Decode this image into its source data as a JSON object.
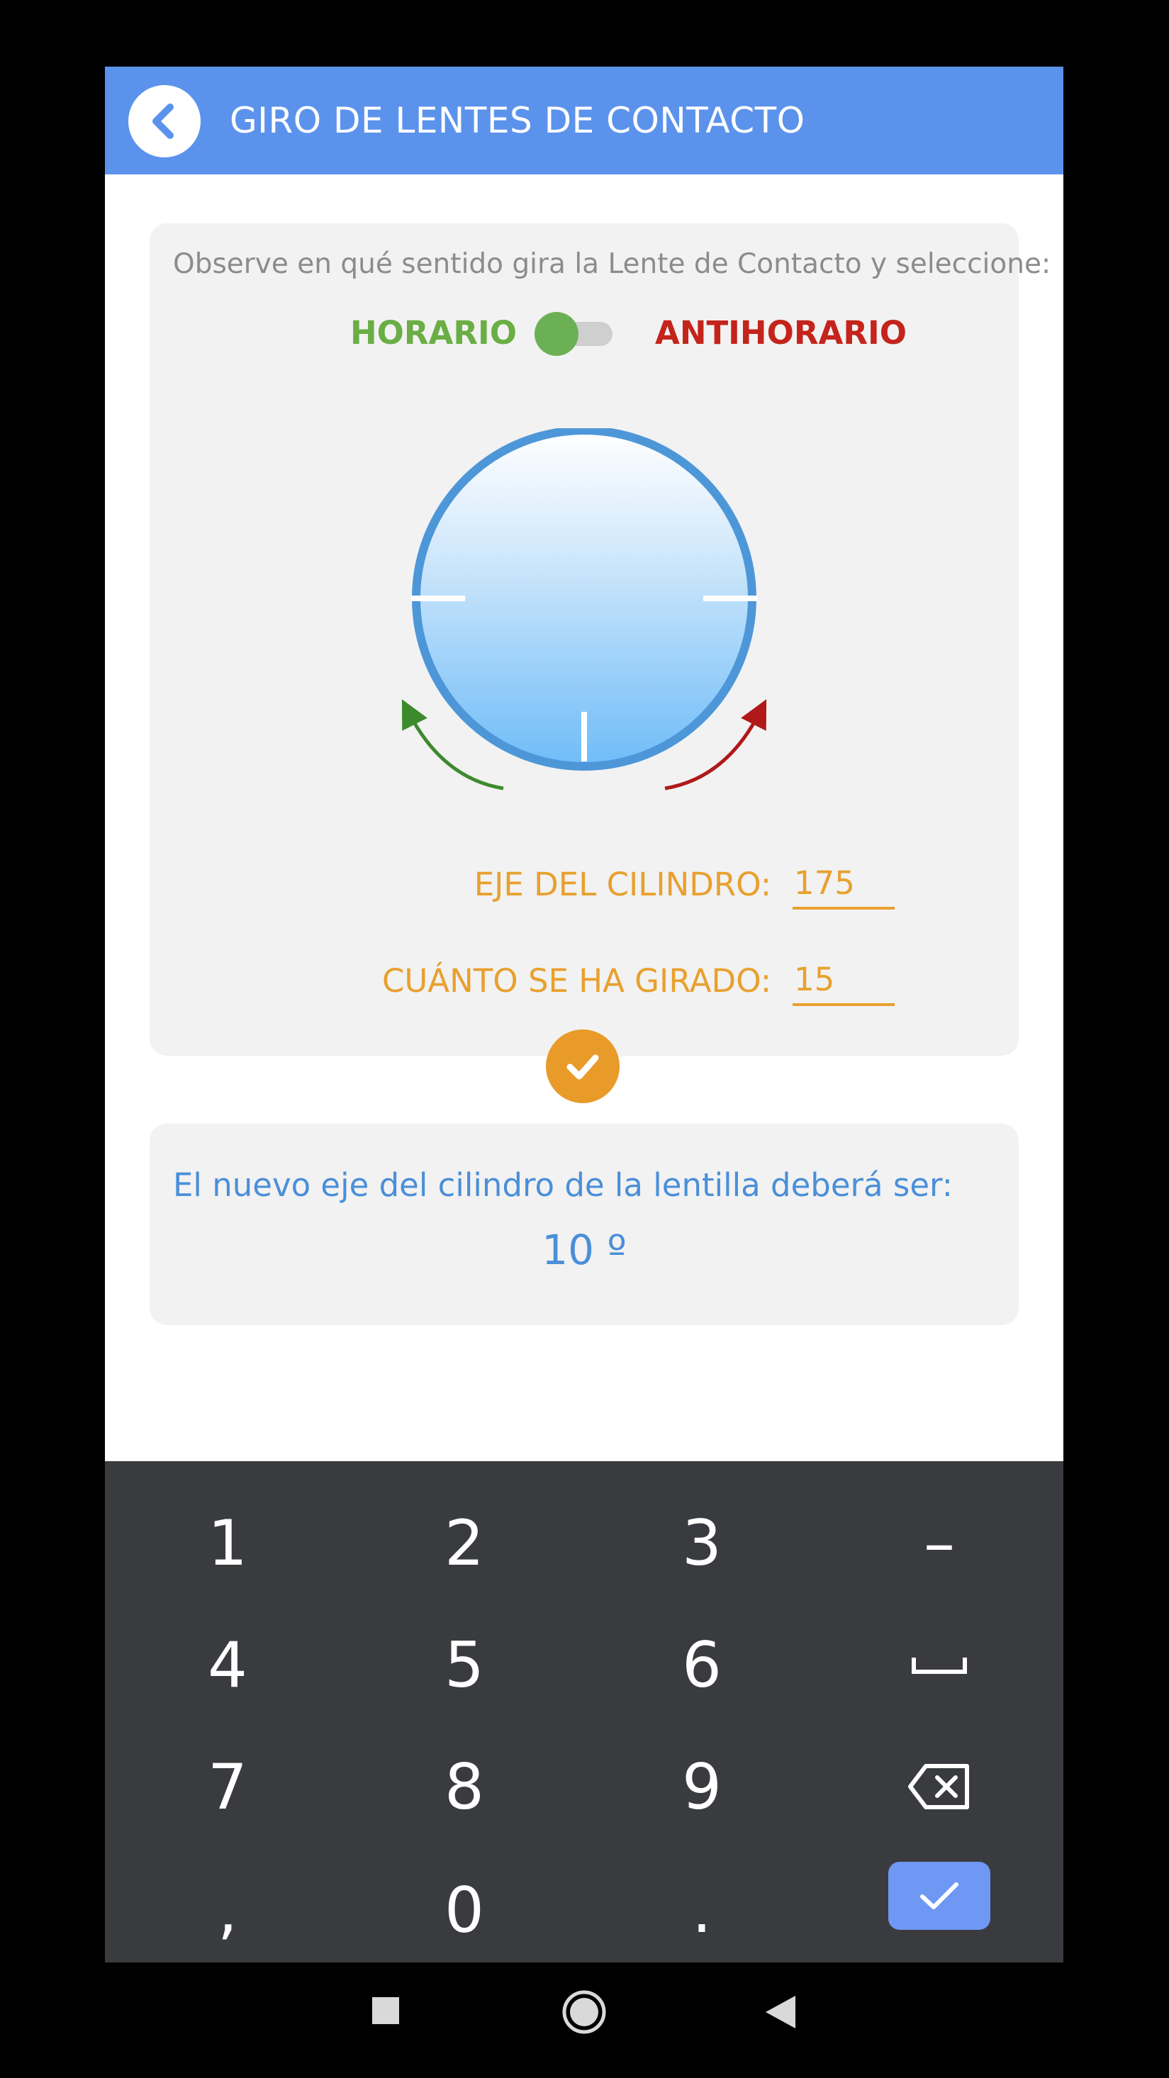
{
  "app": {
    "title": "GIRO DE LENTES DE CONTACTO",
    "primary_color": "#5B93EC"
  },
  "rotation_card": {
    "instruction": "Observe en qué sentido gira la Lente de Contacto y seleccione:",
    "clockwise_label": "HORARIO",
    "counterclockwise_label": "ANTIHORARIO",
    "toggle_selected": "HORARIO",
    "cylinder_axis_label": "EJE DEL CILINDRO:",
    "cylinder_axis_value": "175",
    "rotation_label": "CUÁNTO SE HA GIRADO:",
    "rotation_value": "15",
    "label_color": "#E8A02E"
  },
  "result_card": {
    "text": "El nuevo eje del cilindro de la lentilla deberá ser:",
    "value": "10 º"
  },
  "keyboard": {
    "keys": [
      [
        "1",
        "2",
        "3",
        "–"
      ],
      [
        "4",
        "5",
        "6",
        "space-icon"
      ],
      [
        "7",
        "8",
        "9",
        "backspace-icon"
      ],
      [
        ",",
        "0",
        ".",
        "enter-check-icon"
      ]
    ]
  },
  "system_nav": {
    "buttons": [
      "recents-icon",
      "home-icon",
      "back-icon"
    ]
  }
}
